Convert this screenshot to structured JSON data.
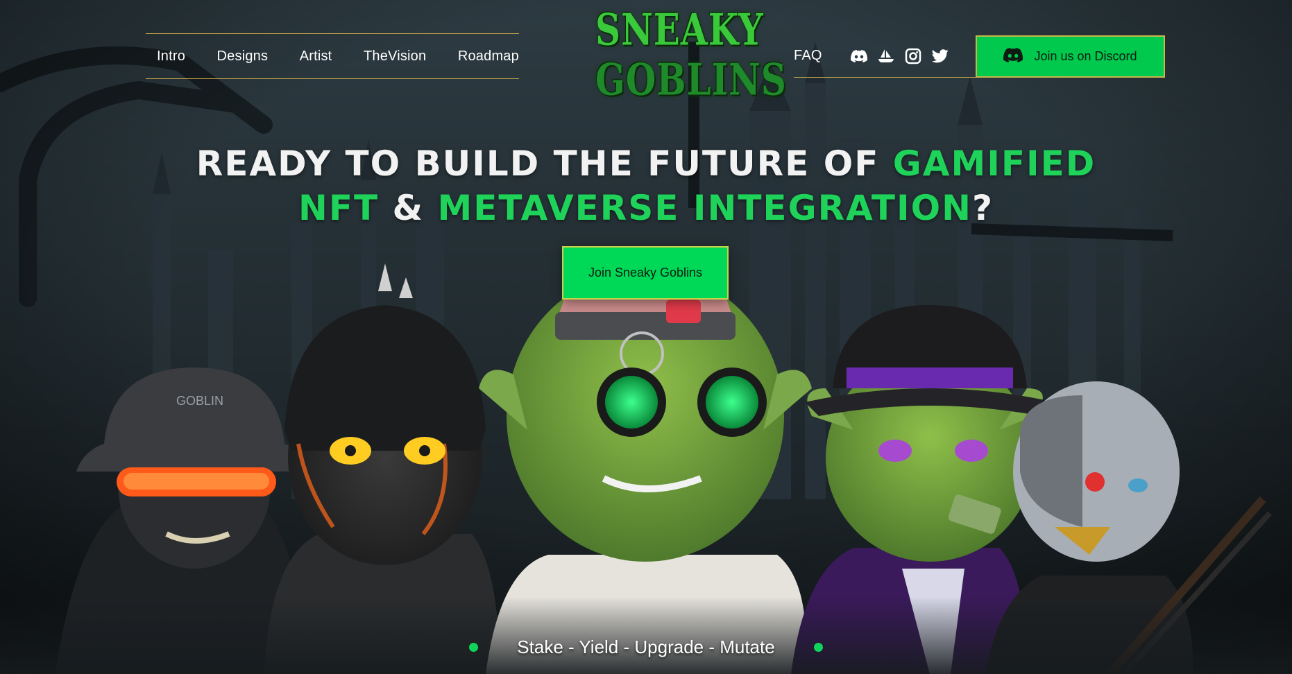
{
  "nav": {
    "left_links": [
      "Intro",
      "Designs",
      "Artist",
      "TheVision",
      "Roadmap"
    ],
    "faq_label": "FAQ",
    "social_icons": [
      "discord-icon",
      "opensea-icon",
      "instagram-icon",
      "twitter-icon"
    ],
    "discord_button_label": "Join us on Discord"
  },
  "logo": {
    "line1": "SNEAKY",
    "line2": "GOBLINS"
  },
  "hero": {
    "line1_white": "READY TO BUILD THE FUTURE OF ",
    "line1_green": "GAMIFIED",
    "line2_green_a": "NFT",
    "line2_white_a": " & ",
    "line2_green_b": "METAVERSE INTEGRATION",
    "line2_white_b": "?",
    "cta_label": "Join Sneaky Goblins"
  },
  "characters": {
    "hat_text": "GOBLIN"
  },
  "tagline": "Stake - Yield - Upgrade - Mutate",
  "colors": {
    "accent_green": "#00d957",
    "gold_border": "#c8a64a",
    "text_green": "#1fd35a"
  }
}
